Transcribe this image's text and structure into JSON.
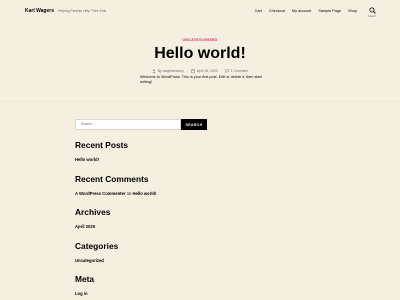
{
  "header": {
    "site_title": "Karl Wagers",
    "site_description": "Helping Parents Help Their Kids",
    "nav": [
      "Cart",
      "Checkout",
      "My account",
      "Sample Page",
      "Shop"
    ],
    "search_label": "Search"
  },
  "post": {
    "category": "UNCATEGORIZED",
    "title": "Hello world!",
    "author": "By wagersmstory",
    "date": "April 18, 2020",
    "comments": "1 Comment",
    "content": "Welcome to WordPress. This is your first post. Edit or delete it, then start writing!"
  },
  "widgets": {
    "search_placeholder": "Search ...",
    "search_button": "SEARCH",
    "recent_posts_title": "Recent Posts",
    "recent_posts": [
      "Hello world!"
    ],
    "recent_comments_title": "Recent Comments",
    "recent_comment_author": "A WordPress Commenter",
    "recent_comment_on": "on",
    "recent_comment_post": "Hello world!",
    "archives_title": "Archives",
    "archives": [
      "April 2020"
    ],
    "categories_title": "Categories",
    "categories": [
      "Uncategorized"
    ],
    "meta_title": "Meta",
    "meta": [
      "Log in"
    ]
  },
  "colors": {
    "background": "#f5efe0",
    "accent": "#cd2653",
    "text": "#000000",
    "muted": "#6d6d6d"
  }
}
